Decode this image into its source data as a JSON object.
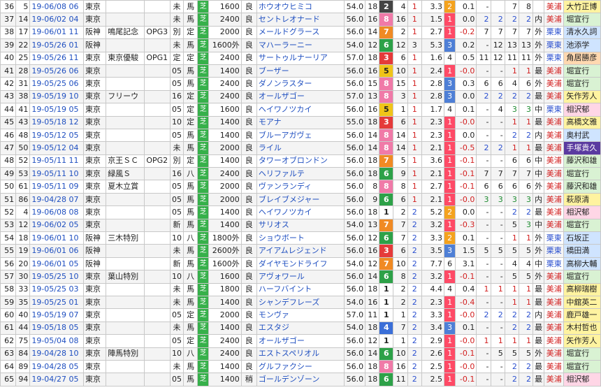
{
  "colors": {
    "turf": "#36b04a",
    "waku": {
      "1": "#ffffff",
      "2": "#444444",
      "3": "#e53a3a",
      "4": "#3b6fd8",
      "5": "#f0c419",
      "6": "#2da148",
      "7": "#f08a24",
      "8": "#f07aa8"
    },
    "pop": {
      "1": "#ff4a66",
      "2": "#f4a21e",
      "3": "#4e7fd6"
    }
  },
  "rows": [
    {
      "no": "36",
      "n": "5",
      "date": "19-06/08 06",
      "place": "東京",
      "race": "",
      "grade": "",
      "cond": "未",
      "type": "馬",
      "surf": "芝",
      "dist": "1600",
      "track": "良",
      "horse": "ホウオウヒミコ",
      "wt": "54.0",
      "hc": "18",
      "waku": "2",
      "num": "4",
      "pop": "1",
      "time": "3.3",
      "po": "2",
      "diff": "0.1",
      "c4": "-",
      "c5": "",
      "c6": "7",
      "c7": "8",
      "pos": "",
      "mark": "美浦",
      "jockey": "大竹正博",
      "jh": "hl-y"
    },
    {
      "no": "37",
      "n": "14",
      "date": "19-06/02 04",
      "place": "東京",
      "race": "",
      "grade": "",
      "cond": "未",
      "type": "馬",
      "surf": "芝",
      "dist": "2400",
      "track": "良",
      "horse": "セントレオナード",
      "wt": "56.0",
      "hc": "16",
      "waku": "8",
      "num": "16",
      "pop": "1",
      "time": "1.5",
      "po": "1",
      "diff": "0.0",
      "c4": "2",
      "c5": "2",
      "c6": "2",
      "c7": "2",
      "pos": "内",
      "mark": "美浦",
      "jockey": "堀宣行",
      "jh": "hl-g"
    },
    {
      "no": "38",
      "n": "17",
      "date": "19-06/01 11",
      "place": "阪神",
      "race": "鳴尾記念",
      "grade": "OPG3",
      "cond": "別",
      "type": "定",
      "surf": "芝",
      "dist": "2000",
      "track": "良",
      "horse": "メールドグラース",
      "wt": "56.0",
      "hc": "14",
      "waku": "7",
      "num": "2",
      "pop": "1",
      "time": "2.7",
      "po": "1",
      "diff": "-0.2",
      "c4": "7",
      "c5": "7",
      "c6": "7",
      "c7": "7",
      "pos": "外",
      "mark": "栗東",
      "jockey": "清水久詞",
      "jh": "hl-b"
    },
    {
      "no": "39",
      "n": "22",
      "date": "19-05/26 01",
      "place": "阪神",
      "race": "",
      "grade": "",
      "cond": "未",
      "type": "馬",
      "surf": "芝",
      "dist": "1600外",
      "track": "良",
      "horse": "マハーラーニー",
      "wt": "54.0",
      "hc": "12",
      "waku": "6",
      "num": "12",
      "pop": "3",
      "time": "5.3",
      "po": "3",
      "diff": "0.2",
      "c4": "-",
      "c5": "12",
      "c6": "13",
      "c7": "13",
      "pos": "外",
      "mark": "栗東",
      "jockey": "池添学",
      "jh": "hl-b"
    },
    {
      "no": "40",
      "n": "25",
      "date": "19-05/26 11",
      "place": "東京",
      "race": "東京優駿",
      "grade": "OPG1",
      "cond": "定",
      "type": "定",
      "surf": "芝",
      "dist": "2400",
      "track": "良",
      "horse": "サートゥルナーリア",
      "wt": "57.0",
      "hc": "18",
      "waku": "3",
      "num": "6",
      "pop": "1",
      "time": "1.6",
      "po": "4",
      "diff": "0.5",
      "c4": "11",
      "c5": "12",
      "c6": "11",
      "c7": "11",
      "pos": "外",
      "mark": "栗東",
      "jockey": "角居勝彦",
      "jh": "hl-o"
    },
    {
      "no": "41",
      "n": "28",
      "date": "19-05/26 06",
      "place": "東京",
      "race": "",
      "grade": "",
      "cond": "05",
      "type": "馬",
      "surf": "芝",
      "dist": "1400",
      "track": "良",
      "horse": "ブーザー",
      "wt": "56.0",
      "hc": "16",
      "waku": "5",
      "num": "10",
      "pop": "1",
      "time": "2.4",
      "po": "1",
      "diff": "-0.0",
      "c4": "-",
      "c5": "-",
      "c6": "1",
      "c7": "1",
      "pos": "最",
      "mark": "美浦",
      "jockey": "堀宣行",
      "jh": "hl-g"
    },
    {
      "no": "42",
      "n": "31",
      "date": "19-05/25 06",
      "place": "東京",
      "race": "",
      "grade": "",
      "cond": "05",
      "type": "馬",
      "surf": "芝",
      "dist": "2400",
      "track": "良",
      "horse": "ダノンラスター",
      "wt": "56.0",
      "hc": "15",
      "waku": "8",
      "num": "15",
      "pop": "1",
      "time": "2.8",
      "po": "3",
      "diff": "0.3",
      "c4": "6",
      "c5": "6",
      "c6": "4",
      "c7": "6",
      "pos": "外",
      "mark": "美浦",
      "jockey": "堀宣行",
      "jh": "hl-g"
    },
    {
      "no": "43",
      "n": "38",
      "date": "19-05/19 10",
      "place": "東京",
      "race": "フリーウ",
      "grade": "",
      "cond": "16",
      "type": "定",
      "surf": "芝",
      "dist": "2400",
      "track": "良",
      "horse": "オールザゴー",
      "wt": "57.0",
      "hc": "13",
      "waku": "8",
      "num": "3",
      "pop": "1",
      "time": "2.8",
      "po": "3",
      "diff": "0.0",
      "c4": "2",
      "c5": "2",
      "c6": "2",
      "c7": "2",
      "pos": "最",
      "mark": "美浦",
      "jockey": "矢作芳人",
      "jh": "hl-y"
    },
    {
      "no": "44",
      "n": "41",
      "date": "19-05/19 05",
      "place": "東京",
      "race": "",
      "grade": "",
      "cond": "05",
      "type": "定",
      "surf": "芝",
      "dist": "1600",
      "track": "良",
      "horse": "ヘイワノツカイ",
      "wt": "56.0",
      "hc": "16",
      "waku": "5",
      "num": "1",
      "pop": "1",
      "time": "1.7",
      "po": "4",
      "diff": "0.1",
      "c4": "-",
      "c5": "4",
      "c6": "3",
      "c7": "3",
      "pos": "中",
      "mark": "栗東",
      "jockey": "相沢郁",
      "jh": "hl-p"
    },
    {
      "no": "45",
      "n": "43",
      "date": "19-05/18 12",
      "place": "東京",
      "race": "",
      "grade": "",
      "cond": "10",
      "type": "定",
      "surf": "芝",
      "dist": "1400",
      "track": "良",
      "horse": "モアナ",
      "wt": "55.0",
      "hc": "18",
      "waku": "3",
      "num": "6",
      "pop": "1",
      "time": "2.3",
      "po": "1",
      "diff": "-0.0",
      "c4": "-",
      "c5": "-",
      "c6": "1",
      "c7": "1",
      "pos": "最",
      "mark": "美浦",
      "jockey": "高橋文雅",
      "jh": "hl-y"
    },
    {
      "no": "46",
      "n": "48",
      "date": "19-05/12 05",
      "place": "東京",
      "race": "",
      "grade": "",
      "cond": "05",
      "type": "馬",
      "surf": "芝",
      "dist": "1400",
      "track": "良",
      "horse": "ブルーアガヴェ",
      "wt": "56.0",
      "hc": "14",
      "waku": "8",
      "num": "14",
      "pop": "1",
      "time": "2.3",
      "po": "1",
      "diff": "0.0",
      "c4": "-",
      "c5": "-",
      "c6": "2",
      "c7": "2",
      "pos": "内",
      "mark": "美浦",
      "jockey": "奥村武",
      "jh": "hl-b"
    },
    {
      "no": "47",
      "n": "50",
      "date": "19-05/12 04",
      "place": "東京",
      "race": "",
      "grade": "",
      "cond": "未",
      "type": "馬",
      "surf": "芝",
      "dist": "2000",
      "track": "良",
      "horse": "ライル",
      "wt": "56.0",
      "hc": "14",
      "waku": "8",
      "num": "14",
      "pop": "1",
      "time": "2.1",
      "po": "1",
      "diff": "-0.5",
      "c4": "2",
      "c5": "2",
      "c6": "1",
      "c7": "1",
      "pos": "最",
      "mark": "美浦",
      "jockey": "手塚貴久",
      "jh": "hl-k"
    },
    {
      "no": "48",
      "n": "52",
      "date": "19-05/11 11",
      "place": "東京",
      "race": "京王ＳＣ",
      "grade": "OPG2",
      "cond": "別",
      "type": "定",
      "surf": "芝",
      "dist": "1400",
      "track": "良",
      "horse": "タワーオブロンドン",
      "wt": "56.0",
      "hc": "18",
      "waku": "7",
      "num": "5",
      "pop": "1",
      "time": "3.6",
      "po": "1",
      "diff": "-0.1",
      "c4": "-",
      "c5": "-",
      "c6": "6",
      "c7": "6",
      "pos": "中",
      "mark": "美浦",
      "jockey": "藤沢和雄",
      "jh": "hl-g"
    },
    {
      "no": "49",
      "n": "53",
      "date": "19-05/11 10",
      "place": "東京",
      "race": "緑風Ｓ",
      "grade": "",
      "cond": "16",
      "type": "八",
      "surf": "芝",
      "dist": "2400",
      "track": "良",
      "horse": "ヘリファルテ",
      "wt": "56.0",
      "hc": "18",
      "waku": "6",
      "num": "9",
      "pop": "1",
      "time": "2.1",
      "po": "1",
      "diff": "-0.1",
      "c4": "7",
      "c5": "7",
      "c6": "7",
      "c7": "7",
      "pos": "中",
      "mark": "美浦",
      "jockey": "堀宣行",
      "jh": "hl-g"
    },
    {
      "no": "50",
      "n": "61",
      "date": "19-05/11 09",
      "place": "東京",
      "race": "夏木立賞",
      "grade": "",
      "cond": "05",
      "type": "馬",
      "surf": "芝",
      "dist": "2000",
      "track": "良",
      "horse": "ヴァンランディ",
      "wt": "56.0",
      "hc": "8",
      "waku": "8",
      "num": "8",
      "pop": "1",
      "time": "2.7",
      "po": "1",
      "diff": "-0.1",
      "c4": "6",
      "c5": "6",
      "c6": "6",
      "c7": "6",
      "pos": "外",
      "mark": "美浦",
      "jockey": "藤沢和雄",
      "jh": "hl-g"
    },
    {
      "no": "51",
      "n": "86",
      "date": "19-04/28 07",
      "place": "東京",
      "race": "",
      "grade": "",
      "cond": "05",
      "type": "馬",
      "surf": "芝",
      "dist": "2000",
      "track": "良",
      "horse": "ブレイブメジャー",
      "wt": "56.0",
      "hc": "9",
      "waku": "6",
      "num": "6",
      "pop": "1",
      "time": "2.1",
      "po": "1",
      "diff": "-0.0",
      "c4": "3",
      "c5": "3",
      "c6": "3",
      "c7": "3",
      "pos": "内",
      "mark": "美浦",
      "jockey": "萩原清",
      "jh": "hl-y"
    },
    {
      "no": "52",
      "n": "4",
      "date": "19-06/08 08",
      "place": "東京",
      "race": "",
      "grade": "",
      "cond": "05",
      "type": "馬",
      "surf": "芝",
      "dist": "1400",
      "track": "良",
      "horse": "ヘイワノツカイ",
      "wt": "56.0",
      "hc": "18",
      "waku": "1",
      "num": "2",
      "pop": "2",
      "time": "5.2",
      "po": "2",
      "diff": "0.0",
      "c4": "-",
      "c5": "-",
      "c6": "2",
      "c7": "2",
      "pos": "最",
      "mark": "美浦",
      "jockey": "相沢郁",
      "jh": "hl-p"
    },
    {
      "no": "53",
      "n": "12",
      "date": "19-06/02 05",
      "place": "東京",
      "race": "",
      "grade": "",
      "cond": "新",
      "type": "馬",
      "surf": "芝",
      "dist": "1400",
      "track": "良",
      "horse": "サリオス",
      "wt": "54.0",
      "hc": "13",
      "waku": "7",
      "num": "7",
      "pop": "2",
      "time": "3.2",
      "po": "1",
      "diff": "-0.3",
      "c4": "-",
      "c5": "-",
      "c6": "5",
      "c7": "3",
      "pos": "中",
      "mark": "美浦",
      "jockey": "堀宣行",
      "jh": "hl-g"
    },
    {
      "no": "54",
      "n": "18",
      "date": "19-06/01 10",
      "place": "阪神",
      "race": "三木特別",
      "grade": "",
      "cond": "10",
      "type": "八",
      "surf": "芝",
      "dist": "1800外",
      "track": "良",
      "horse": "ショウボート",
      "wt": "56.0",
      "hc": "12",
      "waku": "6",
      "num": "7",
      "pop": "2",
      "time": "3.3",
      "po": "2",
      "diff": "0.1",
      "c4": "-",
      "c5": "-",
      "c6": "1",
      "c7": "1",
      "pos": "外",
      "mark": "栗東",
      "jockey": "石坂正",
      "jh": "hl-b"
    },
    {
      "no": "55",
      "n": "19",
      "date": "19-06/01 06",
      "place": "阪神",
      "race": "",
      "grade": "",
      "cond": "未",
      "type": "馬",
      "surf": "芝",
      "dist": "2600外",
      "track": "良",
      "horse": "アイアムレジェンド",
      "wt": "56.0",
      "hc": "16",
      "waku": "3",
      "num": "6",
      "pop": "2",
      "time": "3.5",
      "po": "3",
      "diff": "1.5",
      "c4": "5",
      "c5": "5",
      "c6": "5",
      "c7": "5",
      "pos": "外",
      "mark": "栗東",
      "jockey": "橋田満",
      "jh": "hl-b"
    },
    {
      "no": "56",
      "n": "20",
      "date": "19-06/01 05",
      "place": "阪神",
      "race": "",
      "grade": "",
      "cond": "新",
      "type": "馬",
      "surf": "芝",
      "dist": "1600外",
      "track": "良",
      "horse": "ダイヤモンドライフ",
      "wt": "54.0",
      "hc": "12",
      "waku": "7",
      "num": "10",
      "pop": "2",
      "time": "7.7",
      "po": "6",
      "diff": "3.1",
      "c4": "-",
      "c5": "-",
      "c6": "4",
      "c7": "4",
      "pos": "中",
      "mark": "栗東",
      "jockey": "高柳大輔",
      "jh": "hl-b"
    },
    {
      "no": "57",
      "n": "30",
      "date": "19-05/25 10",
      "place": "東京",
      "race": "葉山特別",
      "grade": "",
      "cond": "10",
      "type": "八",
      "surf": "芝",
      "dist": "1600",
      "track": "良",
      "horse": "アヴォワール",
      "wt": "56.0",
      "hc": "14",
      "waku": "6",
      "num": "8",
      "pop": "2",
      "time": "3.2",
      "po": "1",
      "diff": "-0.1",
      "c4": "-",
      "c5": "-",
      "c6": "5",
      "c7": "5",
      "pos": "外",
      "mark": "美浦",
      "jockey": "堀宣行",
      "jh": "hl-g"
    },
    {
      "no": "58",
      "n": "33",
      "date": "19-05/25 03",
      "place": "東京",
      "race": "",
      "grade": "",
      "cond": "未",
      "type": "馬",
      "surf": "芝",
      "dist": "1800",
      "track": "良",
      "horse": "ハーフバイント",
      "wt": "56.0",
      "hc": "18",
      "waku": "1",
      "num": "2",
      "pop": "2",
      "time": "4.4",
      "po": "4",
      "diff": "0.4",
      "c4": "1",
      "c5": "1",
      "c6": "1",
      "c7": "1",
      "pos": "最",
      "mark": "美浦",
      "jockey": "高柳瑞樹",
      "jh": "hl-y"
    },
    {
      "no": "59",
      "n": "35",
      "date": "19-05/25 01",
      "place": "東京",
      "race": "",
      "grade": "",
      "cond": "未",
      "type": "馬",
      "surf": "芝",
      "dist": "1400",
      "track": "良",
      "horse": "シャンデフレーズ",
      "wt": "54.0",
      "hc": "16",
      "waku": "1",
      "num": "2",
      "pop": "2",
      "time": "2.3",
      "po": "1",
      "diff": "-0.4",
      "c4": "-",
      "c5": "-",
      "c6": "1",
      "c7": "1",
      "pos": "最",
      "mark": "美浦",
      "jockey": "中舘英二",
      "jh": "hl-y"
    },
    {
      "no": "60",
      "n": "40",
      "date": "19-05/19 07",
      "place": "東京",
      "race": "",
      "grade": "",
      "cond": "05",
      "type": "定",
      "surf": "芝",
      "dist": "2000",
      "track": "良",
      "horse": "モンヴァ",
      "wt": "57.0",
      "hc": "11",
      "waku": "1",
      "num": "1",
      "pop": "2",
      "time": "3.3",
      "po": "1",
      "diff": "-0.0",
      "c4": "2",
      "c5": "2",
      "c6": "2",
      "c7": "2",
      "pos": "内",
      "mark": "美浦",
      "jockey": "鹿戸雄一",
      "jh": "hl-y"
    },
    {
      "no": "61",
      "n": "44",
      "date": "19-05/18 05",
      "place": "東京",
      "race": "",
      "grade": "",
      "cond": "未",
      "type": "馬",
      "surf": "芝",
      "dist": "1400",
      "track": "良",
      "horse": "エスタジ",
      "wt": "54.0",
      "hc": "18",
      "waku": "4",
      "num": "7",
      "pop": "2",
      "time": "3.4",
      "po": "3",
      "diff": "0.1",
      "c4": "-",
      "c5": "-",
      "c6": "2",
      "c7": "2",
      "pos": "最",
      "mark": "美浦",
      "jockey": "木村哲也",
      "jh": "hl-y"
    },
    {
      "no": "62",
      "n": "75",
      "date": "19-05/04 08",
      "place": "東京",
      "race": "",
      "grade": "",
      "cond": "05",
      "type": "定",
      "surf": "芝",
      "dist": "2400",
      "track": "良",
      "horse": "オールザゴー",
      "wt": "56.0",
      "hc": "12",
      "waku": "1",
      "num": "1",
      "pop": "2",
      "time": "2.9",
      "po": "1",
      "diff": "-0.0",
      "c4": "1",
      "c5": "1",
      "c6": "1",
      "c7": "1",
      "pos": "最",
      "mark": "美浦",
      "jockey": "矢作芳人",
      "jh": "hl-y"
    },
    {
      "no": "63",
      "n": "84",
      "date": "19-04/28 10",
      "place": "東京",
      "race": "陣馬特別",
      "grade": "",
      "cond": "10",
      "type": "八",
      "surf": "芝",
      "dist": "2400",
      "track": "良",
      "horse": "エストスペリオル",
      "wt": "56.0",
      "hc": "14",
      "waku": "6",
      "num": "10",
      "pop": "2",
      "time": "2.6",
      "po": "1",
      "diff": "-0.1",
      "c4": "-",
      "c5": "5",
      "c6": "5",
      "c7": "5",
      "pos": "外",
      "mark": "美浦",
      "jockey": "堀宣行",
      "jh": "hl-g"
    },
    {
      "no": "64",
      "n": "89",
      "date": "19-04/28 05",
      "place": "東京",
      "race": "",
      "grade": "",
      "cond": "未",
      "type": "馬",
      "surf": "芝",
      "dist": "1400",
      "track": "良",
      "horse": "グルファクシー",
      "wt": "56.0",
      "hc": "18",
      "waku": "8",
      "num": "16",
      "pop": "2",
      "time": "2.5",
      "po": "1",
      "diff": "-0.0",
      "c4": "-",
      "c5": "-",
      "c6": "2",
      "c7": "2",
      "pos": "最",
      "mark": "美浦",
      "jockey": "堀宣行",
      "jh": "hl-g"
    },
    {
      "no": "65",
      "n": "94",
      "date": "19-04/27 05",
      "place": "東京",
      "race": "",
      "grade": "",
      "cond": "05",
      "type": "馬",
      "surf": "芝",
      "dist": "1400",
      "track": "稍",
      "horse": "ゴールデンゾーン",
      "wt": "56.0",
      "hc": "18",
      "waku": "6",
      "num": "11",
      "pop": "2",
      "time": "2.5",
      "po": "1",
      "diff": "-0.1",
      "c4": "-",
      "c5": "-",
      "c6": "2",
      "c7": "2",
      "pos": "最",
      "mark": "美浦",
      "jockey": "相沢郁",
      "jh": "hl-p"
    }
  ]
}
